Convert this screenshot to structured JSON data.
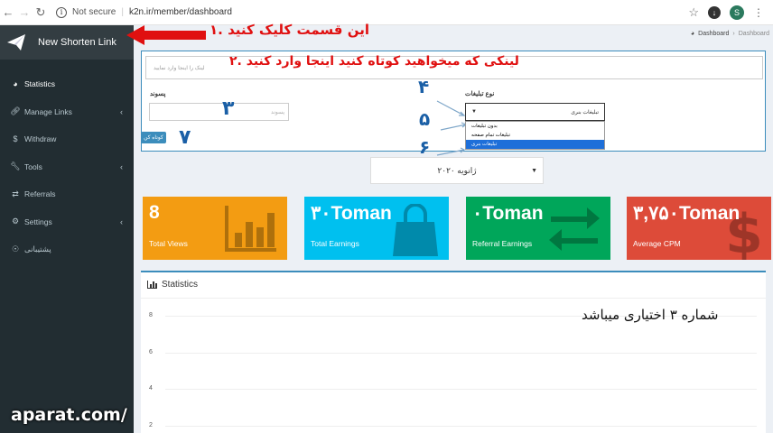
{
  "browser": {
    "security": "Not secure",
    "url": "k2n.ir/member/dashboard",
    "avatar_letter": "S",
    "icons": [
      "back-icon",
      "forward-icon",
      "reload-icon",
      "star-icon",
      "download-icon",
      "menu-dots-icon"
    ]
  },
  "sidebar": {
    "brand_label": "New Shorten Link",
    "items": [
      {
        "label": "Statistics",
        "icon": "dashboard-icon",
        "active": true,
        "has_children": false
      },
      {
        "label": "Manage Links",
        "icon": "link-icon",
        "active": false,
        "has_children": true
      },
      {
        "label": "Withdraw",
        "icon": "dollar-icon",
        "active": false,
        "has_children": false
      },
      {
        "label": "Tools",
        "icon": "wrench-icon",
        "active": false,
        "has_children": true
      },
      {
        "label": "Referrals",
        "icon": "exchange-icon",
        "active": false,
        "has_children": false
      },
      {
        "label": "Settings",
        "icon": "cogs-icon",
        "active": false,
        "has_children": true
      },
      {
        "label": "پشتیبانی",
        "icon": "support-icon",
        "active": false,
        "has_children": false
      }
    ]
  },
  "breadcrumb": {
    "home": "Dashboard",
    "current": "Dashboard"
  },
  "form": {
    "url_placeholder": "لینک را اینجا وارد نمایید",
    "alias_label": "پسوند",
    "alias_placeholder": "پسوند",
    "ad_type_label": "نوع تبلیغات",
    "ad_type_selected": "تبلیغات بنری",
    "ad_type_options": [
      "بدون تبلیغات",
      "تبلیغات تمام صفحه",
      "تبلیغات بنری"
    ],
    "shorten_button": "کوتاه کن"
  },
  "month_select": "ژانویه ۲۰۲۰",
  "stat_boxes": [
    {
      "value": "8",
      "label": "Total Views",
      "color": "#f39c12",
      "icon": "bar-chart-icon"
    },
    {
      "value": "۳۰Toman",
      "label": "Total Earnings",
      "color": "#00c0ef",
      "icon": "shopping-bag-icon"
    },
    {
      "value": "۰Toman",
      "label": "Referral Earnings",
      "color": "#00a65a",
      "icon": "exchange-arrows-icon"
    },
    {
      "value": "۳,۷۵۰Toman",
      "label": "Average CPM",
      "color": "#dd4b39",
      "icon": "dollar-sign-icon"
    }
  ],
  "statistics": {
    "title": "Statistics",
    "y_ticks": [
      "8",
      "6",
      "4",
      "2"
    ]
  },
  "annotations": {
    "step1": "۱. این قسمت کلیک کنید",
    "step2": "۲. لینکی که میخواهید کوتاه کنید اینجا وارد کنید",
    "num3": "۳",
    "num4": "۴",
    "num5": "۵",
    "num6": "۶",
    "num7": "۷",
    "optional_note": "شماره ۳ اختیاری میباشد",
    "red_color": "#e01010",
    "blue_color": "#1a5fa6"
  },
  "watermark": "aparat.com/"
}
